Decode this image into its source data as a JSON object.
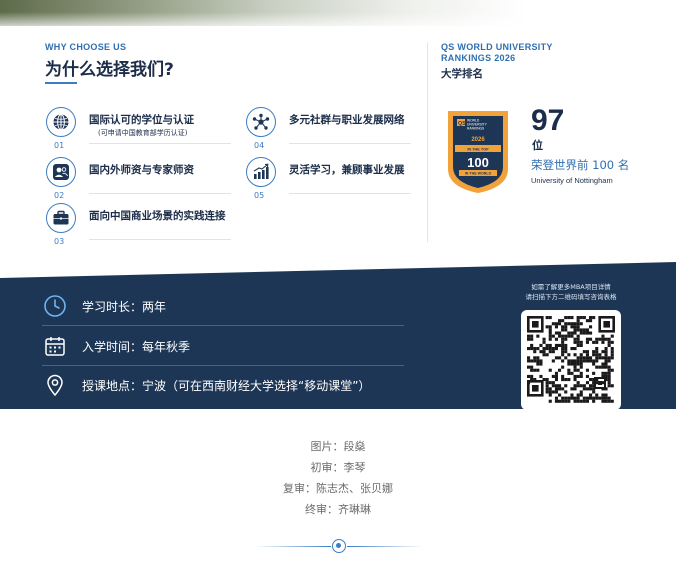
{
  "left": {
    "eyebrow": "WHY CHOOSE US",
    "title": "为什么选择我们?",
    "features": [
      {
        "num": "01",
        "label": "国际认可的学位与认证",
        "sub": "(可申请中国教育部学历认证)",
        "icon": "globe-icon"
      },
      {
        "num": "02",
        "label": "国内外师资与专家师资",
        "sub": "",
        "icon": "people-icon"
      },
      {
        "num": "03",
        "label": "面向中国商业场景的实践连接",
        "sub": "",
        "icon": "briefcase-icon"
      },
      {
        "num": "04",
        "label": "多元社群与职业发展网络",
        "sub": "",
        "icon": "network-icon"
      },
      {
        "num": "05",
        "label": "灵活学习，兼顾事业发展",
        "sub": "",
        "icon": "growth-chart-icon"
      }
    ]
  },
  "ranking": {
    "eyebrow_line1": "QS WORLD UNIVERSITY",
    "eyebrow_line2": "RANKINGS 2026",
    "heading": "大学排名",
    "badge": {
      "line1": "QS",
      "line2": "WORLD",
      "line3": "UNIVERSITY",
      "line4": "RANKINGS",
      "year": "2026",
      "top_text": "IN THE TOP",
      "rank": "100",
      "bottom_text": "IN THE WORLD"
    },
    "rank_value": "97",
    "rank_unit": "位",
    "description": "荣登世界前 100 名",
    "university": "University of Nottingham"
  },
  "program": {
    "duration": "学习时长：两年",
    "intake": "入学时间：每年秋季",
    "location": "授课地点：宁波（可在西南财经大学选择“移动课堂”）",
    "qr_note_line1": "如需了解更多MBA项目详情",
    "qr_note_line2": "请扫描下方二维码填写咨询表格"
  },
  "credits": [
    "图片：段燊",
    "初审：李琴",
    "复审：陈志杰、张贝娜",
    "终审：齐琳琳"
  ],
  "colors": {
    "navy": "#1d3656",
    "accent": "#3b7cc4",
    "badge_orange": "#f2a23a"
  }
}
